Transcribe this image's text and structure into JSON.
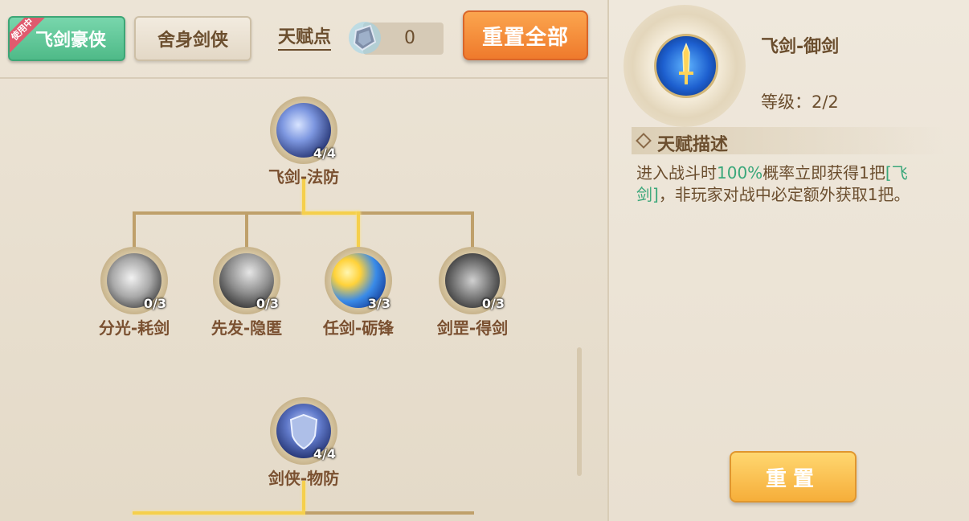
{
  "tabs": {
    "active_label": "飞剑豪侠",
    "active_badge": "使用中",
    "inactive_label": "舍身剑侠"
  },
  "talent_points": {
    "label": "天赋点",
    "value": "0"
  },
  "reset_all_label": "重置全部",
  "tree": {
    "tier1": {
      "label": "飞剑-法防",
      "count": "4/4"
    },
    "tier2": [
      {
        "label": "分光-耗剑",
        "count": "0/3"
      },
      {
        "label": "先发-隐匿",
        "count": "0/3"
      },
      {
        "label": "任剑-砺锋",
        "count": "3/3"
      },
      {
        "label": "剑罡-得剑",
        "count": "0/3"
      }
    ],
    "tier3": {
      "label": "剑侠-物防",
      "count": "4/4"
    }
  },
  "detail": {
    "name": "飞剑-御剑",
    "level_label": "等级：",
    "level_value": "2/2",
    "desc_title": "天赋描述",
    "desc_part1": "进入战斗时",
    "desc_hl1": "100%",
    "desc_part2": "概率立即获得1把",
    "desc_hl2": "[飞剑]",
    "desc_part3": "，非玩家对战中必定额外获取1把。",
    "reset_label": "重置"
  },
  "colors": {
    "accent_green": "#3aa77a",
    "active_path": "#f5cf4c",
    "inactive_path": "#bfa06a",
    "text_brown": "#6b4e2e"
  }
}
